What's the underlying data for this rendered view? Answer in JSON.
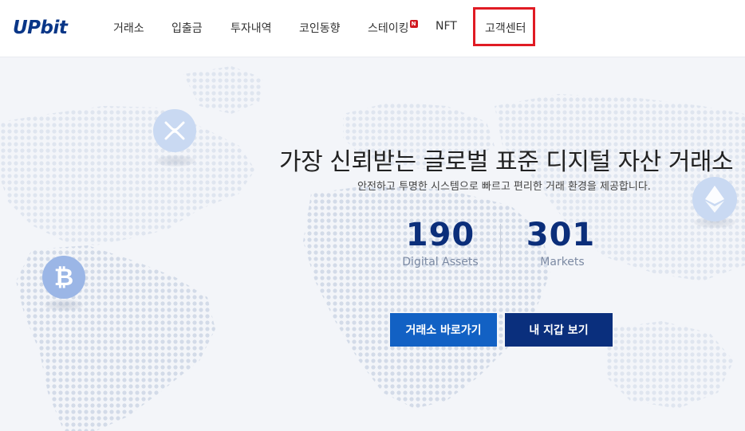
{
  "header": {
    "logo": "UPbit",
    "nav": [
      {
        "label": "거래소"
      },
      {
        "label": "입출금"
      },
      {
        "label": "투자내역"
      },
      {
        "label": "코인동향"
      },
      {
        "label": "스테이킹",
        "badge": "N"
      },
      {
        "label": "NFT"
      },
      {
        "label": "고객센터"
      }
    ]
  },
  "hero": {
    "title": "가장 신뢰받는 글로벌 표준 디지털 자산 거래소",
    "subtitle": "안전하고 투명한 시스템으로 빠르고 편리한 거래 환경을 제공합니다.",
    "stats": [
      {
        "value": "190",
        "label": "Digital Assets"
      },
      {
        "value": "301",
        "label": "Markets"
      }
    ],
    "buttons": {
      "primary": "거래소 바로가기",
      "secondary": "내 지갑 보기"
    }
  },
  "coins": {
    "xrp": {
      "icon": "xrp-icon",
      "color": "#c9d9f2"
    },
    "btc": {
      "icon": "bitcoin-icon",
      "color": "#9bb6e6"
    },
    "eth": {
      "icon": "ethereum-icon",
      "color": "#c9d9f2"
    }
  },
  "colors": {
    "brand": "#093687",
    "primary_button": "#1261c4",
    "secondary_button": "#0a2f7d",
    "highlight": "#e01b24"
  }
}
